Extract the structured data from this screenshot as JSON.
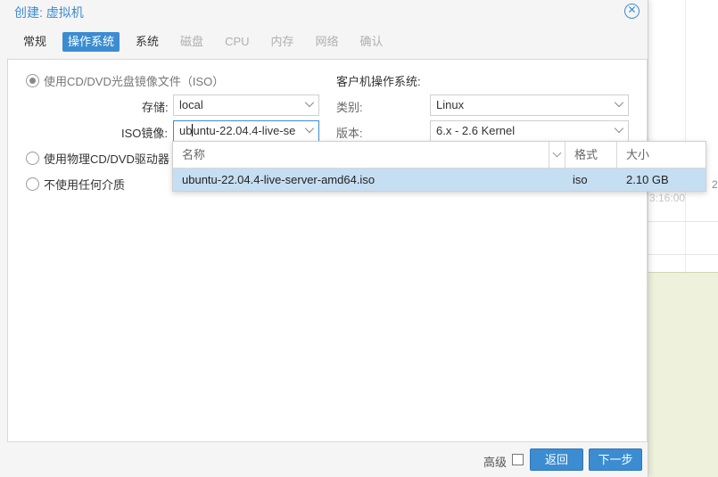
{
  "dialog": {
    "title": "创建: 虚拟机",
    "close_glyph": "✕"
  },
  "tabs": [
    {
      "label": "常规",
      "state": "normal"
    },
    {
      "label": "操作系统",
      "state": "active"
    },
    {
      "label": "系统",
      "state": "normal"
    },
    {
      "label": "磁盘",
      "state": "disabled"
    },
    {
      "label": "CPU",
      "state": "disabled"
    },
    {
      "label": "内存",
      "state": "disabled"
    },
    {
      "label": "网络",
      "state": "disabled"
    },
    {
      "label": "确认",
      "state": "disabled"
    }
  ],
  "media": {
    "option_iso": "使用CD/DVD光盘镜像文件（ISO）",
    "option_physical": "使用物理CD/DVD驱动器",
    "option_none": "不使用任何介质",
    "storage_label": "存储:",
    "storage_value": "local",
    "iso_label": "ISO镜像:",
    "iso_value_before_cursor": "ub",
    "iso_value_after_cursor": "untu-22.04.4-live-se"
  },
  "guest_os": {
    "heading": "客户机操作系统:",
    "type_label": "类别:",
    "type_value": "Linux",
    "version_label": "版本:",
    "version_value": "6.x - 2.6 Kernel"
  },
  "iso_dropdown": {
    "columns": {
      "name": "名称",
      "format": "格式",
      "size": "大小"
    },
    "rows": [
      {
        "name": "ubuntu-22.04.4-live-server-amd64.iso",
        "format": "iso",
        "size": "2.10 GB"
      }
    ]
  },
  "footer": {
    "advanced_label": "高级",
    "back_label": "返回",
    "next_label": "下一步"
  },
  "background": {
    "time_fragment": "3:16:00",
    "edge_fragment": "2"
  },
  "colors": {
    "accent": "#3c8cd1",
    "selected_row": "#c6def2",
    "disabled_text": "#b0b0b0"
  }
}
